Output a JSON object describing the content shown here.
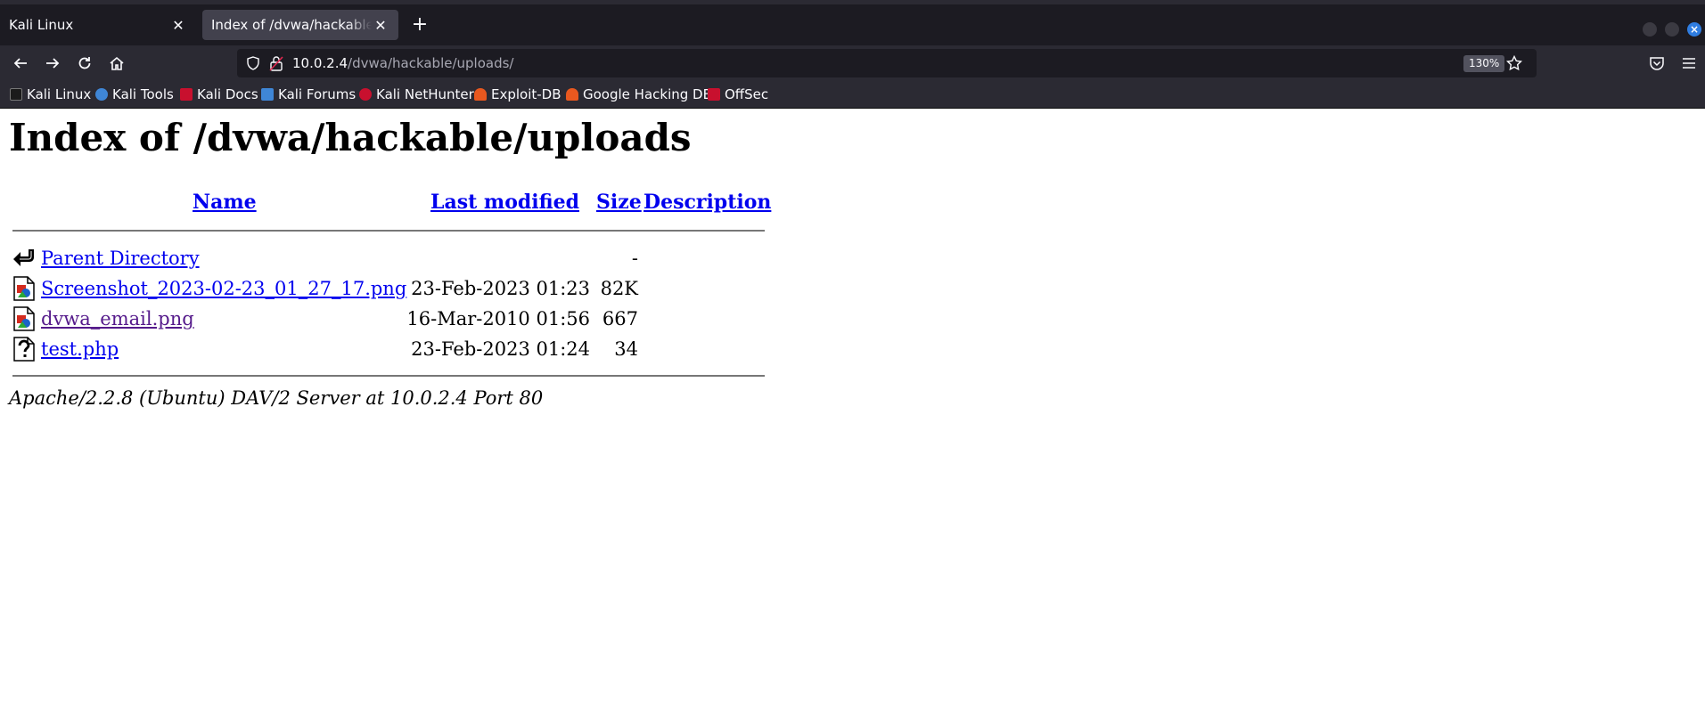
{
  "browser": {
    "tabs": [
      {
        "label": "Kali Linux",
        "active": false
      },
      {
        "label": "Index of /dvwa/hackable/uploads/",
        "active": true
      }
    ],
    "url": {
      "host": "10.0.2.4",
      "path": "/dvwa/hackable/uploads/"
    },
    "zoom": "130%",
    "bookmarks": [
      {
        "label": "Kali Linux",
        "icon": "kali-dragon-icon",
        "color": "#1b1b1b"
      },
      {
        "label": "Kali Tools",
        "icon": "kali-tools-icon",
        "color": "#3f86d6"
      },
      {
        "label": "Kali Docs",
        "icon": "kali-docs-icon",
        "color": "#c8102e"
      },
      {
        "label": "Kali Forums",
        "icon": "kali-forums-icon",
        "color": "#3f86d6"
      },
      {
        "label": "Kali NetHunter",
        "icon": "nethunter-icon",
        "color": "#c8102e"
      },
      {
        "label": "Exploit-DB",
        "icon": "exploit-db-icon",
        "color": "#e8581f"
      },
      {
        "label": "Google Hacking DB",
        "icon": "ghdb-icon",
        "color": "#e8581f"
      },
      {
        "label": "OffSec",
        "icon": "offsec-icon",
        "color": "#c8102e"
      }
    ]
  },
  "page": {
    "title": "Index of /dvwa/hackable/uploads",
    "columns": {
      "name": "Name",
      "modified": "Last modified",
      "size": "Size",
      "description": "Description"
    },
    "rows": [
      {
        "name": "Parent Directory",
        "modified": "",
        "size": "-",
        "icon": "back-arrow-icon",
        "visited": false
      },
      {
        "name": "Screenshot_2023-02-23_01_27_17.png",
        "modified": "23-Feb-2023 01:23",
        "size": "82K",
        "icon": "image-file-icon",
        "visited": false
      },
      {
        "name": "dvwa_email.png",
        "modified": "16-Mar-2010 01:56",
        "size": "667",
        "icon": "image-file-icon",
        "visited": true
      },
      {
        "name": "test.php",
        "modified": "23-Feb-2023 01:24",
        "size": "34",
        "icon": "unknown-file-icon",
        "visited": false
      }
    ],
    "footer": "Apache/2.2.8 (Ubuntu) DAV/2 Server at 10.0.2.4 Port 80"
  },
  "colors": {
    "link": "#0000ee",
    "visited": "#551a8b",
    "chrome_dark": "#1c1b22",
    "chrome_mid": "#2b2a33"
  }
}
